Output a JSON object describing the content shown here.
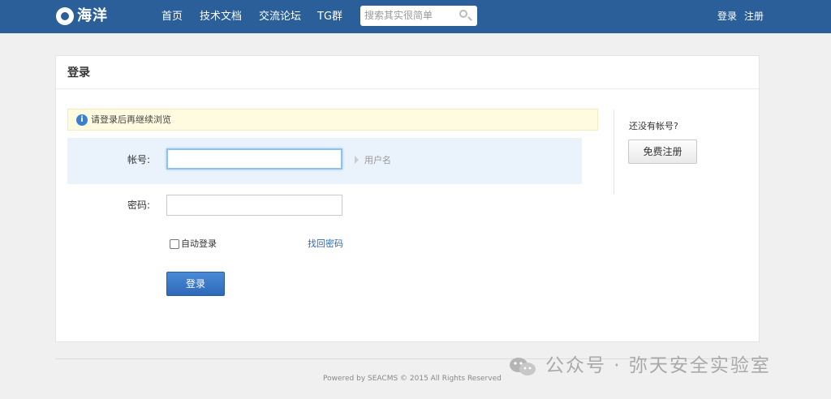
{
  "header": {
    "logo_text": "海洋",
    "nav": [
      "首页",
      "技术文档",
      "交流论坛",
      "TG群"
    ],
    "search_placeholder": "搜索其实很简单",
    "login_link": "登录",
    "register_link": "注册",
    "bg_color": "#2b5f9a"
  },
  "panel": {
    "title": "登录",
    "notice": "请登录后再继续浏览",
    "username_label": "帐号:",
    "username_value": "",
    "username_hint": "用户名",
    "password_label": "密码:",
    "password_value": "",
    "autologin_label": "自动登录",
    "autologin_checked": false,
    "forgot_label": "找回密码",
    "submit_label": "登录"
  },
  "side": {
    "question": "还没有帐号?",
    "register_button": "免费注册"
  },
  "footer": {
    "copyright": "Powered by SEACMS © 2015 All Rights Reserved"
  },
  "watermark": {
    "text": "公众号 · 弥天安全实验室"
  }
}
